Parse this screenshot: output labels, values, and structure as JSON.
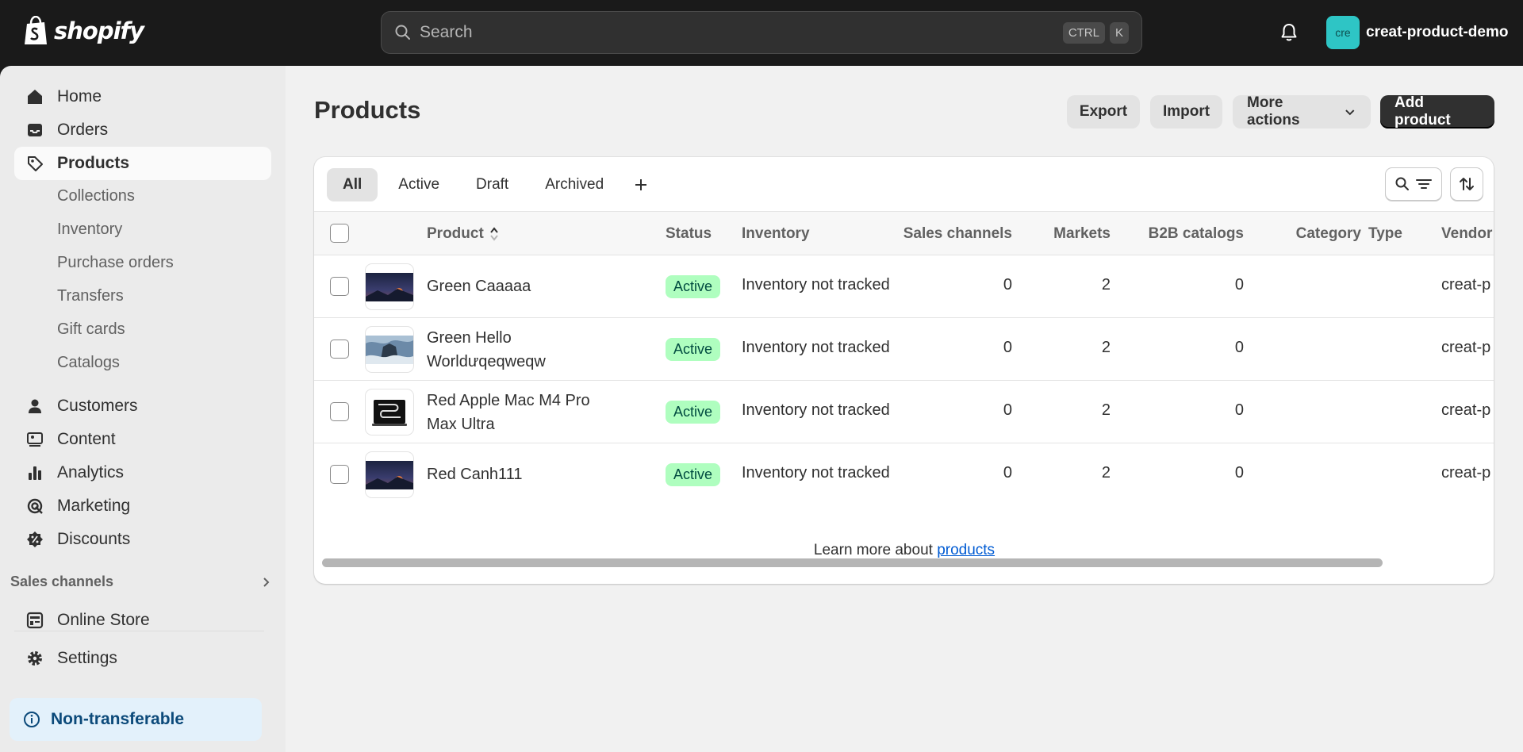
{
  "topbar": {
    "logo_text": "shopify",
    "search_placeholder": "Search",
    "shortcut_keys": [
      "CTRL",
      "K"
    ],
    "store_initials": "cre",
    "store_name": "creat-product-demo"
  },
  "sidebar": {
    "items": [
      {
        "label": "Home",
        "icon": "home-icon"
      },
      {
        "label": "Orders",
        "icon": "inbox-icon"
      },
      {
        "label": "Products",
        "icon": "tag-icon",
        "selected": true
      }
    ],
    "product_subitems": [
      "Collections",
      "Inventory",
      "Purchase orders",
      "Transfers",
      "Gift cards",
      "Catalogs"
    ],
    "items2": [
      {
        "label": "Customers",
        "icon": "person-icon"
      },
      {
        "label": "Content",
        "icon": "content-icon"
      },
      {
        "label": "Analytics",
        "icon": "bar-chart-icon"
      },
      {
        "label": "Marketing",
        "icon": "target-icon"
      },
      {
        "label": "Discounts",
        "icon": "discount-icon"
      }
    ],
    "sales_channels_heading": "Sales channels",
    "online_store": "Online Store",
    "settings": "Settings",
    "non_transferable": "Non-transferable"
  },
  "page": {
    "title": "Products",
    "export": "Export",
    "import": "Import",
    "more_actions": "More actions",
    "add_product": "Add product"
  },
  "tabs": [
    "All",
    "Active",
    "Draft",
    "Archived"
  ],
  "table": {
    "headers": {
      "product": "Product",
      "status": "Status",
      "inventory": "Inventory",
      "sales_channels": "Sales channels",
      "markets": "Markets",
      "b2b": "B2B catalogs",
      "category": "Category",
      "type": "Type",
      "vendor": "Vendor"
    },
    "rows": [
      {
        "name": "Green Caaaaa",
        "status": "Active",
        "inventory": "Inventory not tracked",
        "sales": "0",
        "markets": "2",
        "b2b": "0",
        "vendor": "creat-p"
      },
      {
        "name": "Green Hello Worlduqeqweqw",
        "name_l1": "Green Hello",
        "name_l2": "Worldưqeqweqw",
        "status": "Active",
        "inventory": "Inventory not tracked",
        "sales": "0",
        "markets": "2",
        "b2b": "0",
        "vendor": "creat-p"
      },
      {
        "name": "Red Apple Mac M4 Pro Max Ultra",
        "name_l1": "Red Apple Mac M4 Pro",
        "name_l2": "Max Ultra",
        "status": "Active",
        "inventory": "Inventory not tracked",
        "sales": "0",
        "markets": "2",
        "b2b": "0",
        "vendor": "creat-p"
      },
      {
        "name": "Red Canh111",
        "status": "Active",
        "inventory": "Inventory not tracked",
        "sales": "0",
        "markets": "2",
        "b2b": "0",
        "vendor": "creat-p"
      }
    ]
  },
  "footer": {
    "learn_text": "Learn more about ",
    "learn_link": "products"
  },
  "colors": {
    "topbar": "#1a1a1a",
    "accent": "#303030",
    "active_badge_bg": "#affebf",
    "active_badge_text": "#014b40",
    "store_avatar": "#2ec5c5",
    "link": "#005bd3"
  }
}
